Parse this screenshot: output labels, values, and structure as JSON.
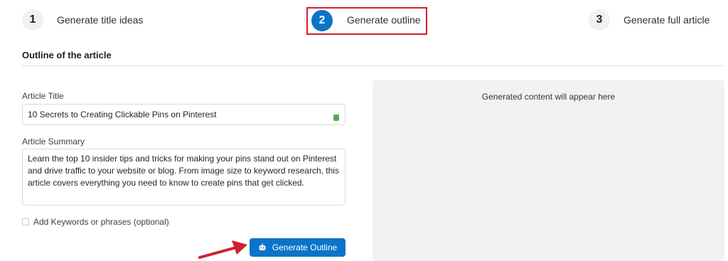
{
  "steps": [
    {
      "number": "1",
      "label": "Generate title ideas"
    },
    {
      "number": "2",
      "label": "Generate outline"
    },
    {
      "number": "3",
      "label": "Generate full article"
    }
  ],
  "section_title": "Outline of the article",
  "form": {
    "article_title_label": "Article Title",
    "article_title_value": "10 Secrets to Creating Clickable Pins on Pinterest",
    "article_summary_label": "Article Summary",
    "article_summary_value": "Learn the top 10 insider tips and tricks for making your pins stand out on Pinterest and drive traffic to your website or blog. From image size to keyword research, this article covers everything you need to know to create pins that get clicked.",
    "keywords_checkbox_label": "Add Keywords or phrases (optional)",
    "generate_button_label": "Generate Outline"
  },
  "preview": {
    "placeholder": "Generated content will appear here"
  },
  "colors": {
    "accent": "#0a74c9",
    "annotation_red": "#d11f2f"
  }
}
